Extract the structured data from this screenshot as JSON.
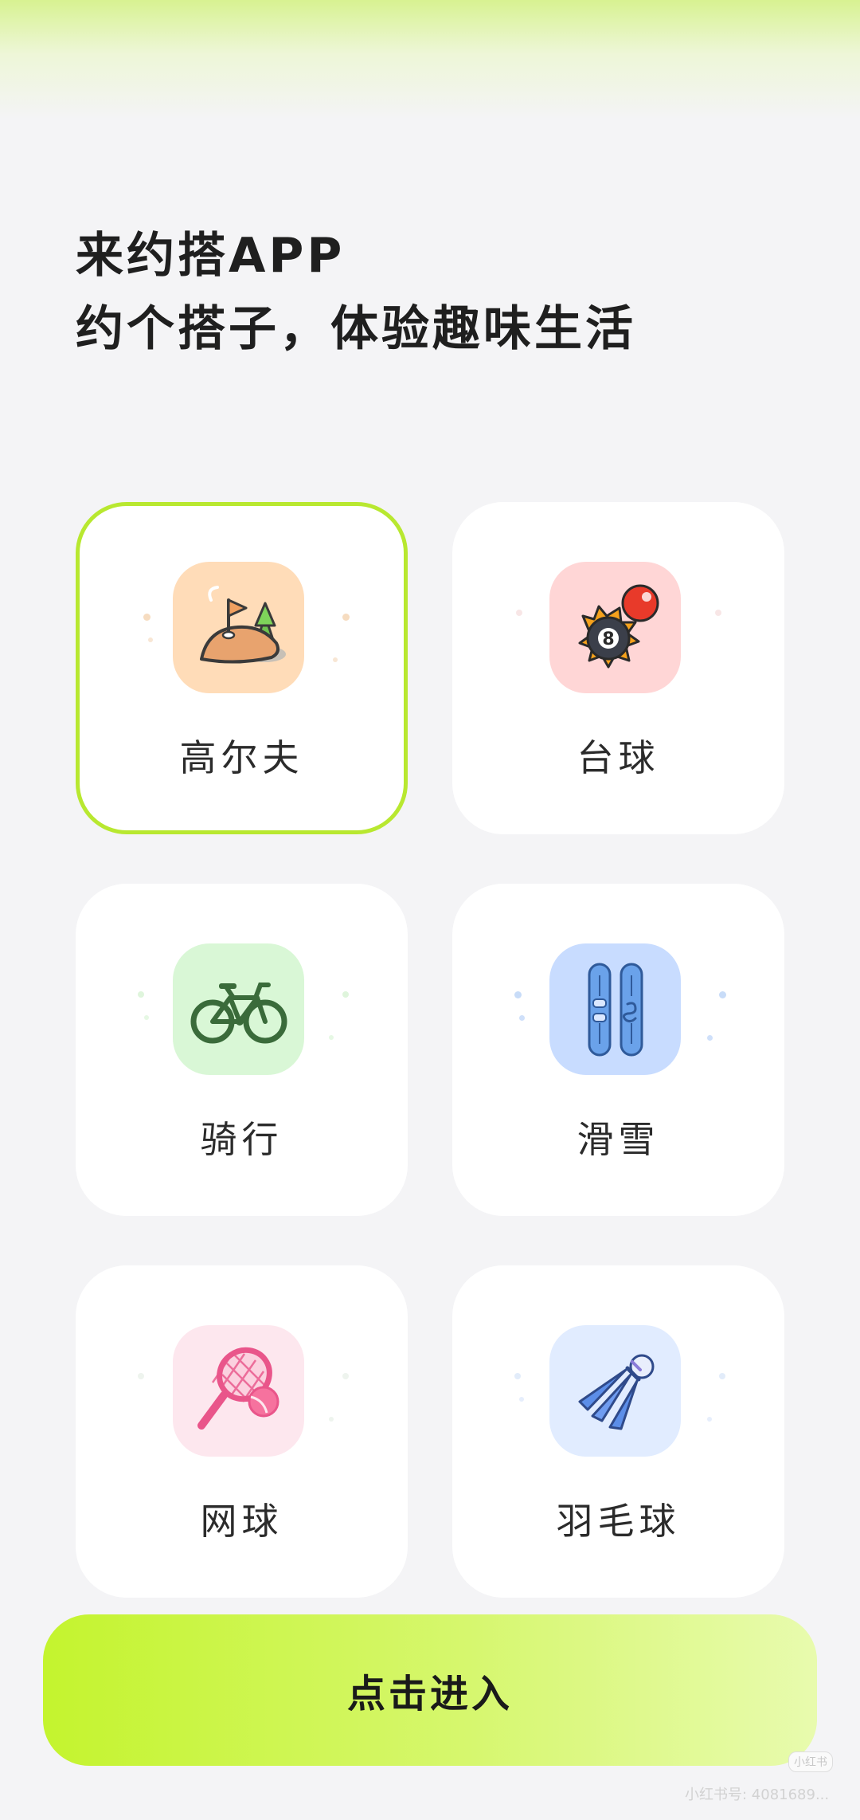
{
  "header": {
    "line1": "来约搭APP",
    "line2": "约个搭子，体验趣味生活"
  },
  "sports": [
    {
      "label": "高尔夫",
      "icon": "golf-icon",
      "selected": true,
      "bg": "#ffdcb8"
    },
    {
      "label": "台球",
      "icon": "billiards-icon",
      "selected": false,
      "bg": "#ffd6d6"
    },
    {
      "label": "骑行",
      "icon": "bicycle-icon",
      "selected": false,
      "bg": "#d9f7d6"
    },
    {
      "label": "滑雪",
      "icon": "snowboard-icon",
      "selected": false,
      "bg": "#c8dcff"
    },
    {
      "label": "网球",
      "icon": "tennis-icon",
      "selected": false,
      "bg": "#fde7ee"
    },
    {
      "label": "羽毛球",
      "icon": "badminton-icon",
      "selected": false,
      "bg": "#e1ecff"
    }
  ],
  "cta": {
    "label": "点击进入"
  },
  "watermark": {
    "badge": "小红书",
    "id": "小红书号: 4081689..."
  },
  "colors": {
    "accent": "#c4f42e",
    "selected_border": "#b8e830",
    "background": "#f4f4f6"
  }
}
